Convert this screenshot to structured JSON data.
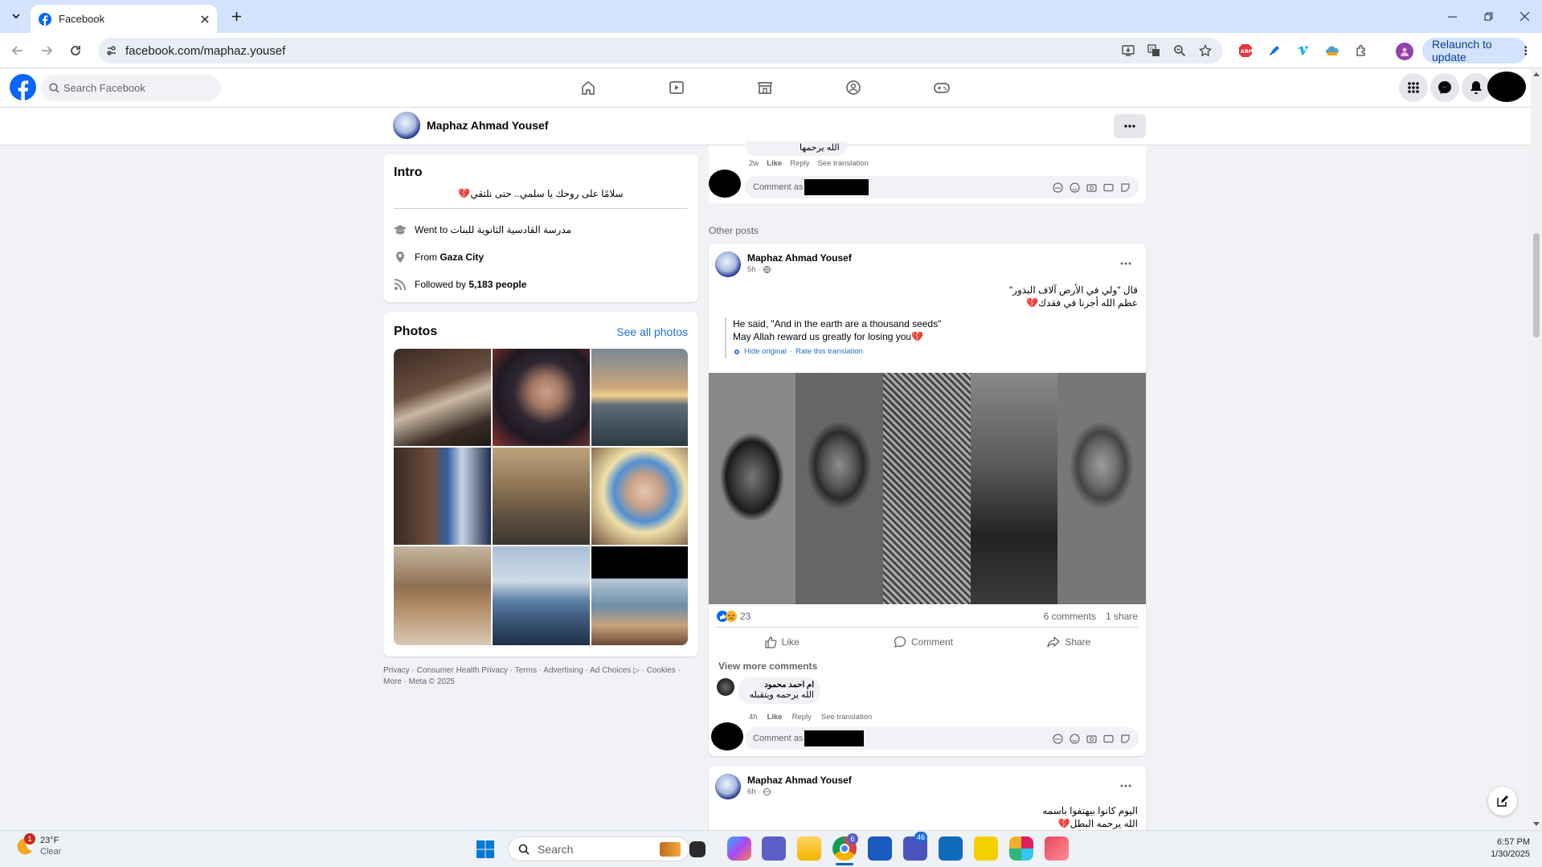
{
  "browser": {
    "tab_title": "Facebook",
    "url": "facebook.com/maphaz.yousef",
    "relaunch_label": "Relaunch to update"
  },
  "facebook": {
    "search_placeholder": "Search Facebook",
    "profile_name": "Maphaz Ahmad Yousef"
  },
  "top_comment": {
    "text": "الله يرحمها",
    "time": "2w",
    "like": "Like",
    "reply": "Reply",
    "see_translation": "See translation",
    "comment_as": "Comment as"
  },
  "intro": {
    "title": "Intro",
    "bio": "سلامًا على روحك يا سلمي.. حتى نلتقي💔",
    "went_prefix": "Went to",
    "school": "مدرسة القادسية الثانوية للبنات",
    "from_prefix": "From",
    "city": "Gaza City",
    "followed_prefix": "Followed by",
    "followers": "5,183 people"
  },
  "photos": {
    "title": "Photos",
    "see_all": "See all photos"
  },
  "footer": {
    "line1": "Privacy · Consumer Health Privacy · Terms · Advertising · Ad Choices ▷ · Cookies ·",
    "line2": "More · Meta © 2025"
  },
  "other_posts_label": "Other posts",
  "post1": {
    "author": "Maphaz Ahmad Yousef",
    "time": "5h",
    "line1": "قال \"ولي في الأرض آلاف البذور\"",
    "line2": "عظم الله أجرنا في فقدك💔",
    "trans1": "He said, \"And in the earth are a thousand seeds\"",
    "trans2": "May Allah reward us greatly for losing you💔",
    "hide_original": "Hide original",
    "rate": "Rate this translation",
    "reactions": "23",
    "comments": "6 comments",
    "shares": "1 share",
    "like": "Like",
    "comment": "Comment",
    "share": "Share",
    "view_more": "View more comments",
    "c_author": "ام احمد محمود",
    "c_text": "الله يرحمه ويتقبله",
    "c_time": "4h",
    "c_like": "Like",
    "c_reply": "Reply",
    "c_see": "See translation",
    "comment_as": "Comment as"
  },
  "post2": {
    "author": "Maphaz Ahmad Yousef",
    "time": "6h",
    "line1": "اليوم كانوا بيهتفوا باسمه",
    "line2": "الله يرحمه البطل💔"
  },
  "taskbar": {
    "temp": "23°F",
    "weather": "Clear",
    "weather_badge": "1",
    "search": "Search",
    "chrome_badge": "6",
    "teams_badge": "46",
    "time": "6:57 PM",
    "date": "1/30/2025"
  },
  "colors": {
    "fb_blue": "#0866ff",
    "link_blue": "#216fdb",
    "heart_red": "#e41e3f"
  }
}
